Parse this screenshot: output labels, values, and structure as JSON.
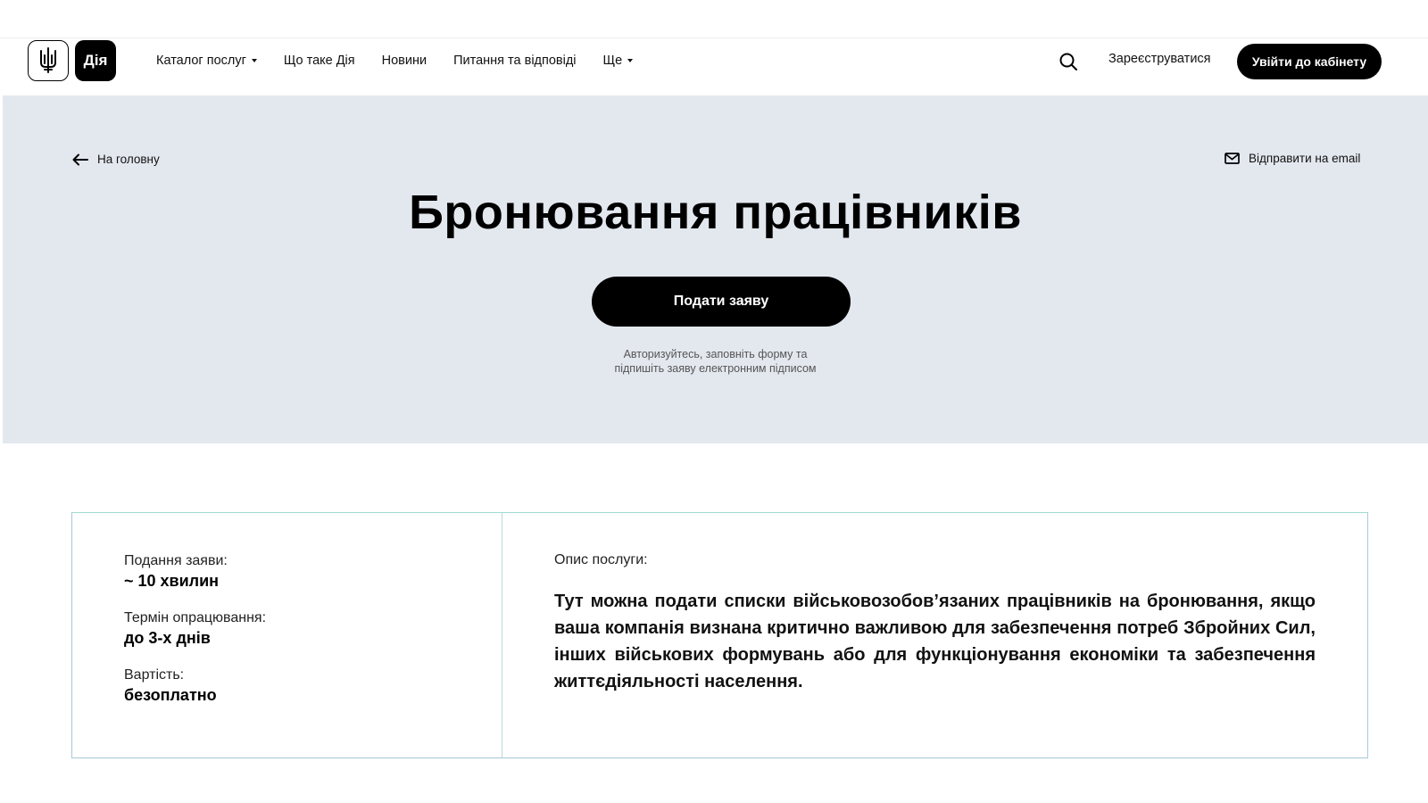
{
  "header": {
    "logo_text": "Дія",
    "nav": [
      {
        "label": "Каталог послуг",
        "dropdown": true
      },
      {
        "label": "Що таке Дія",
        "dropdown": false
      },
      {
        "label": "Новини",
        "dropdown": false
      },
      {
        "label": "Питання та відповіді",
        "dropdown": false
      },
      {
        "label": "Ще",
        "dropdown": true
      }
    ],
    "register_label": "Зареєструватися",
    "login_label": "Увійти до кабінету"
  },
  "hero": {
    "back_label": "На головну",
    "email_label": "Відправити на email",
    "title": "Бронювання працівників",
    "apply_label": "Подати заяву",
    "hint_line1": "Авторизуйтесь, заповніть форму та",
    "hint_line2": "підпишіть заяву електронним підписом",
    "background_color": "#e3e8ef"
  },
  "info": {
    "items": [
      {
        "label": "Подання заяви:",
        "value": "~ 10 хвилин"
      },
      {
        "label": "Термін опрацювання:",
        "value": "до 3-х днів"
      },
      {
        "label": "Вартість:",
        "value": "безоплатно"
      }
    ],
    "description_label": "Опис послуги:",
    "description": "Тут можна подати списки військовозобов’язаних працівників на бронювання, якщо ваша компанія визнана критично важливою для забезпечення потреб Збройних Сил, інших військових формувань або для функціонування економіки та забезпечення життєдіяльності населення."
  },
  "icons": {
    "logo": "trident-icon",
    "search": "search-icon",
    "back": "arrow-left-icon",
    "email": "mail-icon"
  }
}
